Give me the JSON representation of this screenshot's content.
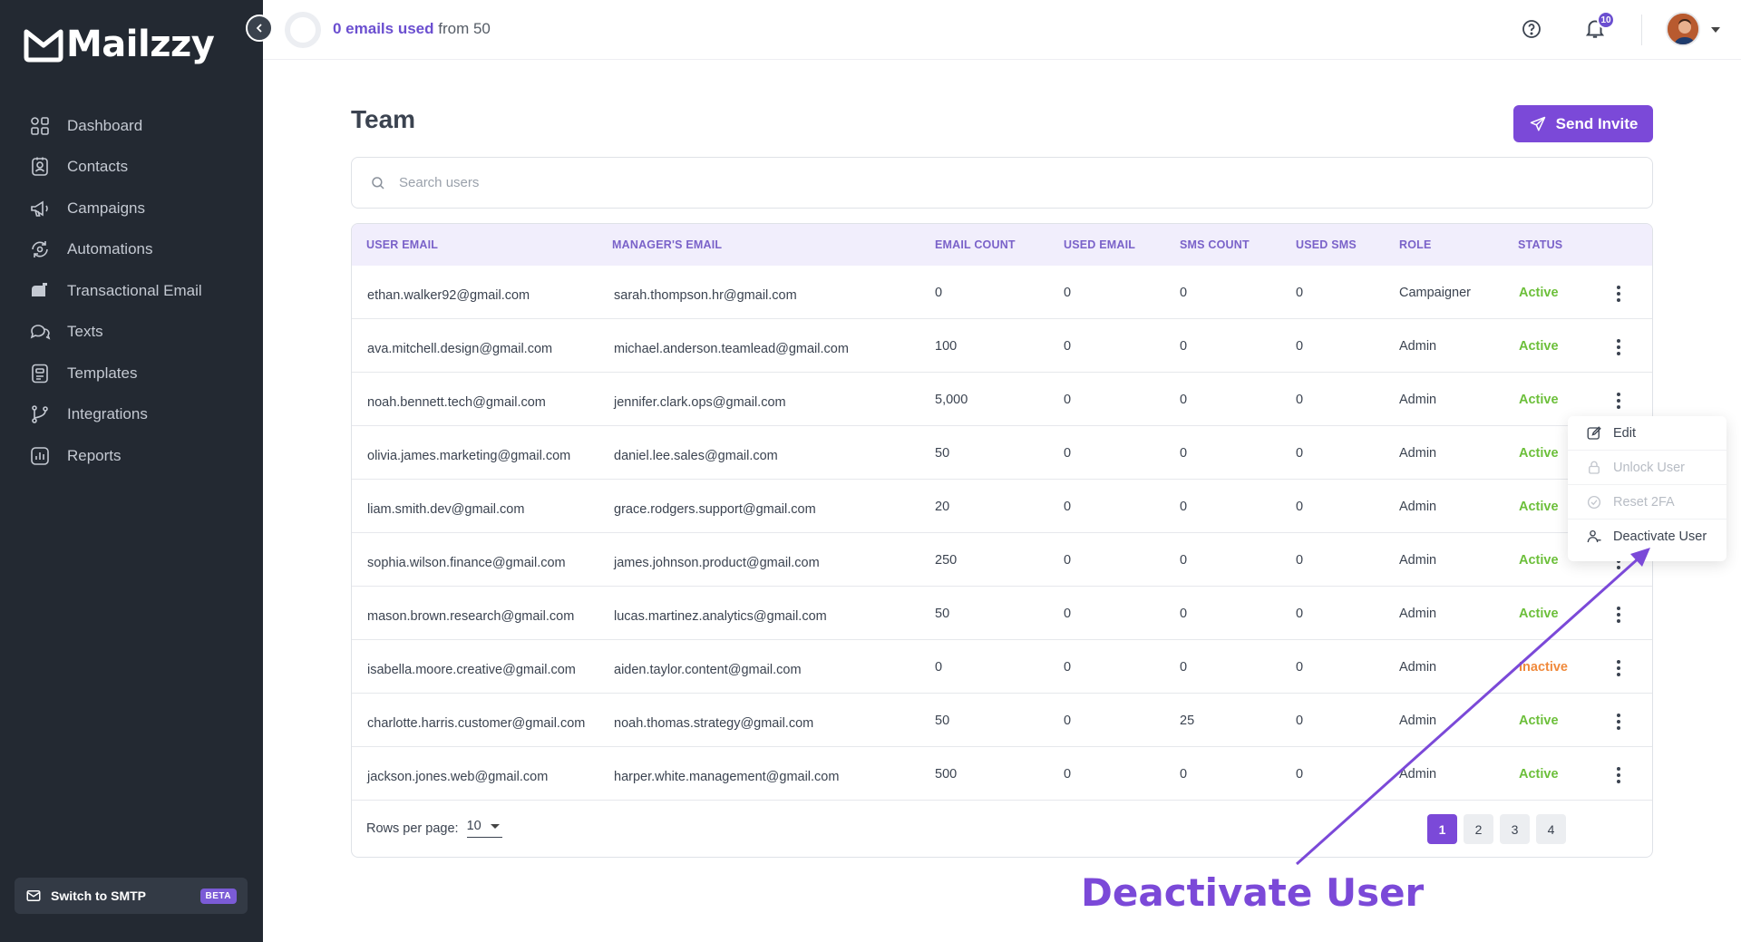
{
  "app": {
    "name": "Mailzzy"
  },
  "sidebar": {
    "items": [
      {
        "label": "Dashboard",
        "icon": "dashboard-icon"
      },
      {
        "label": "Contacts",
        "icon": "contacts-icon"
      },
      {
        "label": "Campaigns",
        "icon": "megaphone-icon"
      },
      {
        "label": "Automations",
        "icon": "automations-icon"
      },
      {
        "label": "Transactional Email",
        "icon": "mailbox-icon"
      },
      {
        "label": "Texts",
        "icon": "chat-icon"
      },
      {
        "label": "Templates",
        "icon": "templates-icon"
      },
      {
        "label": "Integrations",
        "icon": "branch-icon"
      },
      {
        "label": "Reports",
        "icon": "reports-icon"
      }
    ],
    "smtp": {
      "label": "Switch to SMTP",
      "badge": "BETA"
    }
  },
  "topbar": {
    "usage_strong": "0 emails used",
    "usage_rest": " from 50",
    "notification_count": "10"
  },
  "page": {
    "title": "Team",
    "send_invite_label": "Send Invite",
    "search_placeholder": "Search users"
  },
  "table": {
    "headers": [
      "USER EMAIL",
      "MANAGER'S EMAIL",
      "EMAIL COUNT",
      "USED EMAIL",
      "SMS COUNT",
      "USED SMS",
      "ROLE",
      "STATUS"
    ],
    "rows": [
      {
        "user": "ethan.walker92@gmail.com",
        "manager": "sarah.thompson.hr@gmail.com",
        "email_count": "0",
        "used_email": "0",
        "sms_count": "0",
        "used_sms": "0",
        "role": "Campaigner",
        "status": "Active"
      },
      {
        "user": "ava.mitchell.design@gmail.com",
        "manager": "michael.anderson.teamlead@gmail.com",
        "email_count": "100",
        "used_email": "0",
        "sms_count": "0",
        "used_sms": "0",
        "role": "Admin",
        "status": "Active"
      },
      {
        "user": "noah.bennett.tech@gmail.com",
        "manager": "jennifer.clark.ops@gmail.com",
        "email_count": "5,000",
        "used_email": "0",
        "sms_count": "0",
        "used_sms": "0",
        "role": "Admin",
        "status": "Active"
      },
      {
        "user": "olivia.james.marketing@gmail.com",
        "manager": "daniel.lee.sales@gmail.com",
        "email_count": "50",
        "used_email": "0",
        "sms_count": "0",
        "used_sms": "0",
        "role": "Admin",
        "status": "Active"
      },
      {
        "user": "liam.smith.dev@gmail.com",
        "manager": "grace.rodgers.support@gmail.com",
        "email_count": "20",
        "used_email": "0",
        "sms_count": "0",
        "used_sms": "0",
        "role": "Admin",
        "status": "Active"
      },
      {
        "user": "sophia.wilson.finance@gmail.com",
        "manager": "james.johnson.product@gmail.com",
        "email_count": "250",
        "used_email": "0",
        "sms_count": "0",
        "used_sms": "0",
        "role": "Admin",
        "status": "Active"
      },
      {
        "user": "mason.brown.research@gmail.com",
        "manager": "lucas.martinez.analytics@gmail.com",
        "email_count": "50",
        "used_email": "0",
        "sms_count": "0",
        "used_sms": "0",
        "role": "Admin",
        "status": "Active"
      },
      {
        "user": "isabella.moore.creative@gmail.com",
        "manager": "aiden.taylor.content@gmail.com",
        "email_count": "0",
        "used_email": "0",
        "sms_count": "0",
        "used_sms": "0",
        "role": "Admin",
        "status": "Inactive"
      },
      {
        "user": "charlotte.harris.customer@gmail.com",
        "manager": "noah.thomas.strategy@gmail.com",
        "email_count": "50",
        "used_email": "0",
        "sms_count": "25",
        "used_sms": "0",
        "role": "Admin",
        "status": "Active"
      },
      {
        "user": "jackson.jones.web@gmail.com",
        "manager": "harper.white.management@gmail.com",
        "email_count": "500",
        "used_email": "0",
        "sms_count": "0",
        "used_sms": "0",
        "role": "Admin",
        "status": "Active"
      }
    ],
    "rows_per_page_label": "Rows per page:",
    "rows_per_page_value": "10",
    "pages": [
      "1",
      "2",
      "3",
      "4"
    ],
    "current_page": "1"
  },
  "menu": {
    "items": [
      {
        "label": "Edit",
        "icon": "edit-icon",
        "disabled": false
      },
      {
        "label": "Unlock User",
        "icon": "lock-icon",
        "disabled": true
      },
      {
        "label": "Reset 2FA",
        "icon": "shield-check-icon",
        "disabled": true
      },
      {
        "label": "Deactivate User",
        "icon": "user-remove-icon",
        "disabled": false
      }
    ]
  },
  "annotation": {
    "label": "Deactivate User"
  },
  "colors": {
    "accent": "#7b49d8",
    "sidebar": "#232932",
    "active": "#6cbf3a",
    "inactive": "#f08a3c"
  }
}
